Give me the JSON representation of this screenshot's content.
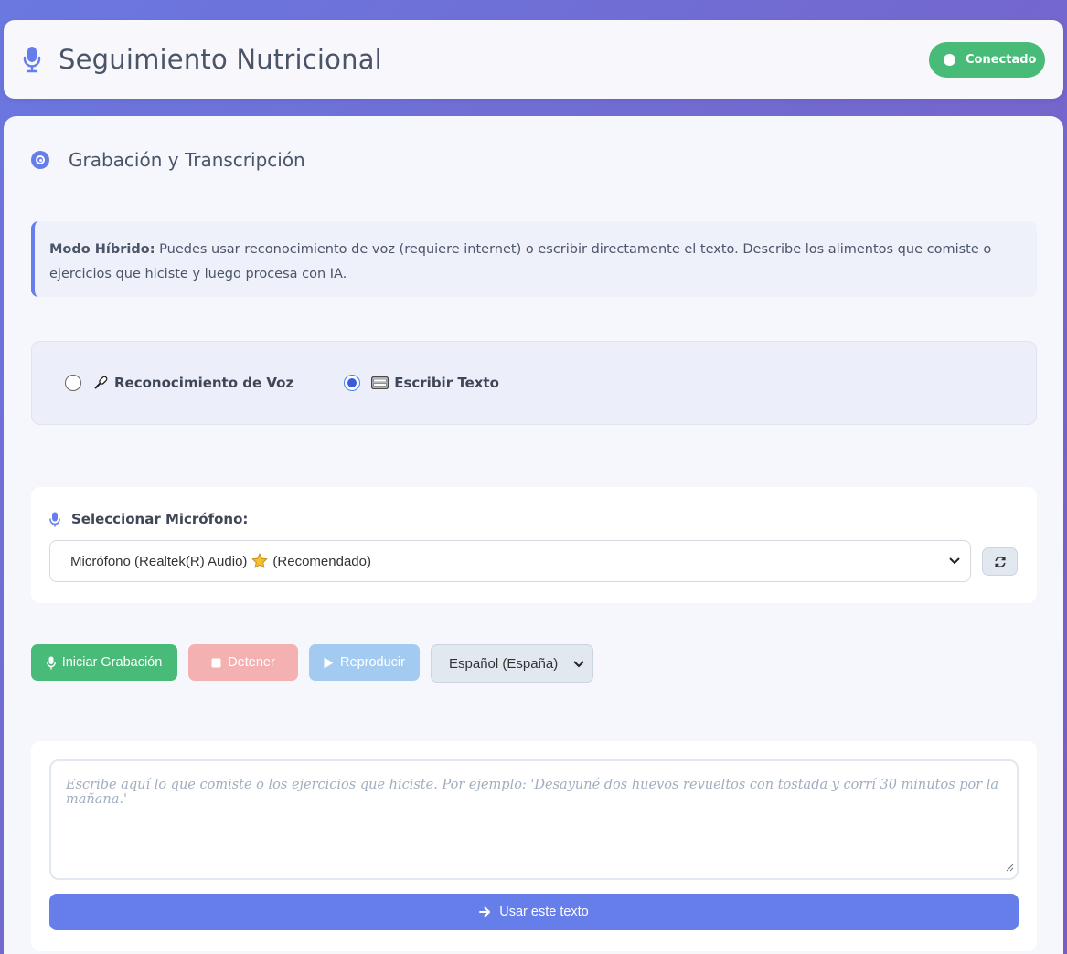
{
  "header": {
    "title": "Seguimiento Nutricional",
    "status": "Conectado",
    "icon": "microphone-icon"
  },
  "section": {
    "title": "Grabación y Transcripción",
    "icon": "target-icon"
  },
  "info": {
    "bold": "Modo Híbrido:",
    "text": " Puedes usar reconocimiento de voz (requiere internet) o escribir directamente el texto. Describe los alimentos que comiste o ejercicios que hiciste y luego procesa con IA."
  },
  "modes": {
    "voice_label": "Reconocimiento de Voz",
    "voice_icon": "microphone-icon",
    "text_label": "Escribir Texto",
    "text_icon": "keyboard-icon",
    "selected": "text"
  },
  "microphone": {
    "label": "Seleccionar Micrófono:",
    "selected_prefix": "Micrófono (Realtek(R) Audio)",
    "selected_suffix": "(Recomendado)",
    "star_icon": "star-icon"
  },
  "controls": {
    "start": "Iniciar Grabación",
    "stop": "Detener",
    "play": "Reproducir",
    "language": "Español (España)"
  },
  "input": {
    "placeholder": "Escribe aquí lo que comiste o los ejercicios que hiciste. Por ejemplo: 'Desayuné dos huevos revueltos con tostada y corrí 30 minutos por la mañana.'",
    "use_button": "Usar este texto"
  },
  "colors": {
    "accent": "#667eea",
    "success": "#48bb78",
    "danger_disabled": "#f4b1b1",
    "info_disabled": "#a3cbf2"
  }
}
